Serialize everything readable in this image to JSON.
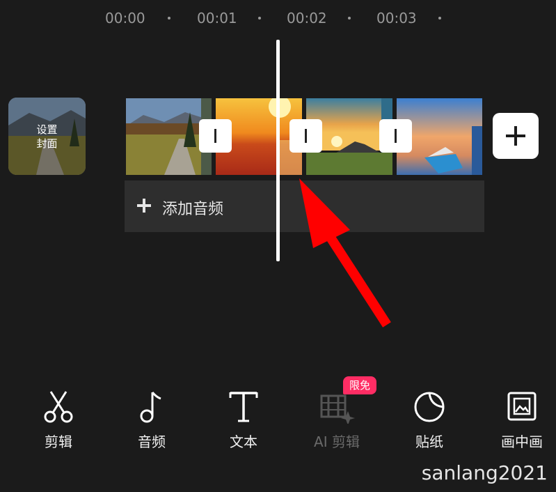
{
  "timeline": {
    "ruler": [
      "00:00",
      "00:01",
      "00:02",
      "00:03"
    ]
  },
  "cover": {
    "label": "设置\n封面"
  },
  "clips": [
    {
      "name": "autumn-road-clip"
    },
    {
      "name": "sunset-ocean-clip"
    },
    {
      "name": "sunrise-field-clip"
    },
    {
      "name": "boat-sky-clip"
    }
  ],
  "audio": {
    "add_label": "添加音频"
  },
  "toolbar": {
    "items": [
      {
        "label": "剪辑",
        "icon": "scissors-icon"
      },
      {
        "label": "音频",
        "icon": "music-note-icon"
      },
      {
        "label": "文本",
        "icon": "text-icon"
      },
      {
        "label": "AI 剪辑",
        "icon": "ai-film-icon",
        "disabled": true
      },
      {
        "label": "贴纸",
        "icon": "sticker-icon"
      },
      {
        "label": "画中画",
        "icon": "picture-in-picture-icon"
      }
    ],
    "badge": "限免"
  },
  "watermark": "sanlang2021",
  "colors": {
    "background": "#1b1b1b",
    "badge": "#ff2d64",
    "annotation_arrow": "#ff0000"
  }
}
